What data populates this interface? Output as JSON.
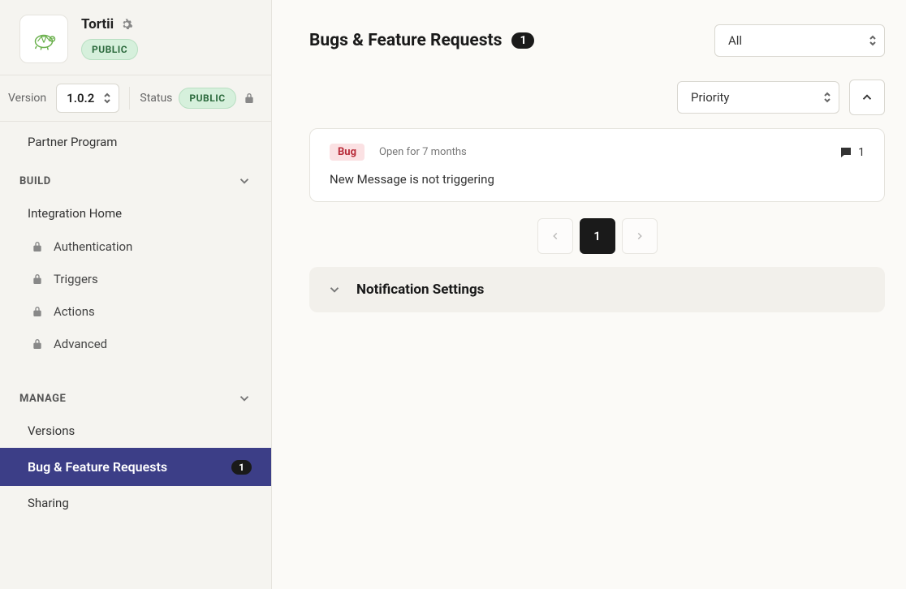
{
  "app": {
    "name": "Tortii",
    "visibility": "PUBLIC"
  },
  "versionBar": {
    "versionLabel": "Version",
    "versionValue": "1.0.2",
    "statusLabel": "Status",
    "statusValue": "PUBLIC"
  },
  "sidebar": {
    "topItem": "Partner Program",
    "sections": {
      "build": {
        "label": "BUILD",
        "items": {
          "integrationHome": "Integration Home",
          "authentication": "Authentication",
          "triggers": "Triggers",
          "actions": "Actions",
          "advanced": "Advanced"
        }
      },
      "manage": {
        "label": "MANAGE",
        "items": {
          "versions": "Versions",
          "bugFeature": "Bug & Feature Requests",
          "bugFeatureCount": "1",
          "sharing": "Sharing"
        }
      }
    }
  },
  "main": {
    "title": "Bugs & Feature Requests",
    "count": "1",
    "filter1": "All",
    "filter2": "Priority",
    "issues": [
      {
        "type": "Bug",
        "openFor": "Open for 7 months",
        "comments": "1",
        "title": "New Message is not triggering"
      }
    ],
    "pagination": {
      "current": "1"
    },
    "notificationSection": "Notification Settings"
  }
}
